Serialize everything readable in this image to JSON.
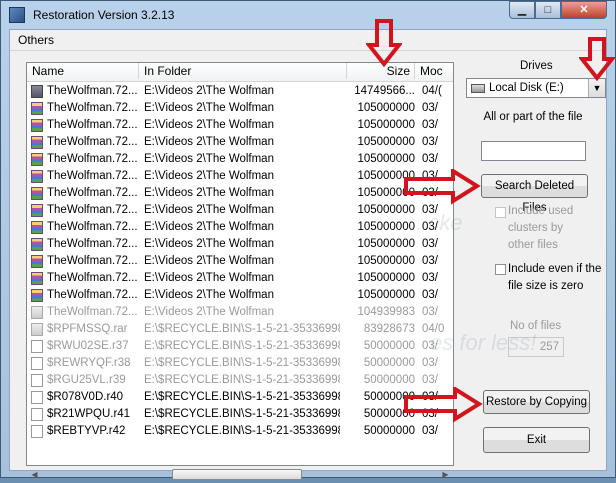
{
  "window": {
    "title": "Restoration Version 3.2.13"
  },
  "menu": {
    "others": "Others"
  },
  "columns": {
    "name": "Name",
    "folder": "In Folder",
    "size": "Size",
    "modified": "Moc"
  },
  "rows": [
    {
      "name": "TheWolfman.72...",
      "folder": "E:\\Videos 2\\The Wolfman",
      "size": "14749566...",
      "mod": "04/(",
      "icon": "disk-image-icon",
      "grey": false
    },
    {
      "name": "TheWolfman.72...",
      "folder": "E:\\Videos 2\\The Wolfman",
      "size": "105000000",
      "mod": "03/",
      "icon": "rar-archive-icon",
      "grey": false
    },
    {
      "name": "TheWolfman.72...",
      "folder": "E:\\Videos 2\\The Wolfman",
      "size": "105000000",
      "mod": "03/",
      "icon": "rar-archive-icon",
      "grey": false
    },
    {
      "name": "TheWolfman.72...",
      "folder": "E:\\Videos 2\\The Wolfman",
      "size": "105000000",
      "mod": "03/",
      "icon": "rar-archive-icon",
      "grey": false
    },
    {
      "name": "TheWolfman.72...",
      "folder": "E:\\Videos 2\\The Wolfman",
      "size": "105000000",
      "mod": "03/",
      "icon": "rar-archive-icon",
      "grey": false
    },
    {
      "name": "TheWolfman.72...",
      "folder": "E:\\Videos 2\\The Wolfman",
      "size": "105000000",
      "mod": "03/",
      "icon": "rar-archive-icon",
      "grey": false
    },
    {
      "name": "TheWolfman.72...",
      "folder": "E:\\Videos 2\\The Wolfman",
      "size": "105000000",
      "mod": "03/",
      "icon": "rar-archive-icon",
      "grey": false
    },
    {
      "name": "TheWolfman.72...",
      "folder": "E:\\Videos 2\\The Wolfman",
      "size": "105000000",
      "mod": "03/",
      "icon": "rar-archive-icon",
      "grey": false
    },
    {
      "name": "TheWolfman.72...",
      "folder": "E:\\Videos 2\\The Wolfman",
      "size": "105000000",
      "mod": "03/",
      "icon": "rar-archive-icon",
      "grey": false
    },
    {
      "name": "TheWolfman.72...",
      "folder": "E:\\Videos 2\\The Wolfman",
      "size": "105000000",
      "mod": "03/",
      "icon": "rar-archive-icon",
      "grey": false
    },
    {
      "name": "TheWolfman.72...",
      "folder": "E:\\Videos 2\\The Wolfman",
      "size": "105000000",
      "mod": "03/",
      "icon": "rar-archive-icon",
      "grey": false
    },
    {
      "name": "TheWolfman.72...",
      "folder": "E:\\Videos 2\\The Wolfman",
      "size": "105000000",
      "mod": "03/",
      "icon": "rar-archive-icon",
      "grey": false
    },
    {
      "name": "TheWolfman.72...",
      "folder": "E:\\Videos 2\\The Wolfman",
      "size": "105000000",
      "mod": "03/",
      "icon": "rar-archive-icon",
      "grey": false
    },
    {
      "name": "TheWolfman.72...",
      "folder": "E:\\Videos 2\\The Wolfman",
      "size": "104939983",
      "mod": "03/",
      "icon": "rar-archive-icon",
      "grey": true
    },
    {
      "name": "$RPFMSSQ.rar",
      "folder": "E:\\$RECYCLE.BIN\\S-1-5-21-35336998...",
      "size": "83928673",
      "mod": "04/0",
      "icon": "rar-archive-icon",
      "grey": true
    },
    {
      "name": "$RWU02SE.r37",
      "folder": "E:\\$RECYCLE.BIN\\S-1-5-21-35336998...",
      "size": "50000000",
      "mod": "03/",
      "icon": "blank-file-icon",
      "grey": true
    },
    {
      "name": "$REWRYQF.r38",
      "folder": "E:\\$RECYCLE.BIN\\S-1-5-21-35336998...",
      "size": "50000000",
      "mod": "03/",
      "icon": "blank-file-icon",
      "grey": true
    },
    {
      "name": "$RGU25VL.r39",
      "folder": "E:\\$RECYCLE.BIN\\S-1-5-21-35336998...",
      "size": "50000000",
      "mod": "03/",
      "icon": "blank-file-icon",
      "grey": true
    },
    {
      "name": "$R078V0D.r40",
      "folder": "E:\\$RECYCLE.BIN\\S-1-5-21-35336998...",
      "size": "50000000",
      "mod": "03/",
      "icon": "blank-file-icon",
      "grey": false
    },
    {
      "name": "$R21WPQU.r41",
      "folder": "E:\\$RECYCLE.BIN\\S-1-5-21-35336998...",
      "size": "50000000",
      "mod": "03/",
      "icon": "blank-file-icon",
      "grey": false
    },
    {
      "name": "$REBTYVP.r42",
      "folder": "E:\\$RECYCLE.BIN\\S-1-5-21-35336998...",
      "size": "50000000",
      "mod": "03/",
      "icon": "blank-file-icon",
      "grey": false
    }
  ],
  "drives": {
    "label": "Drives",
    "selected": "Local Disk (E:)"
  },
  "search": {
    "label": "All or part of the file",
    "value": ""
  },
  "buttons": {
    "search_deleted": "Search Deleted Files",
    "restore": "Restore by Copying",
    "exit": "Exit"
  },
  "options": {
    "include_used": "Include used clusters by other files",
    "include_zero": "Include even if the file size is zero"
  },
  "file_count": {
    "label": "No of files",
    "value": "257"
  },
  "watermark": {
    "text1": "...cke",
    "text2": "es for less!"
  },
  "colors": {
    "arrow_red": "#d4141c"
  }
}
